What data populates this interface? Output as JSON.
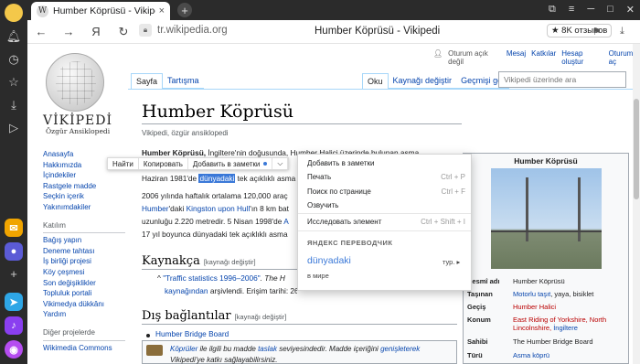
{
  "browser": {
    "tab_title": "Humber Köprüsü - Vikipedi",
    "tab_favicon": "W",
    "new_tab": "+",
    "url": "tr.wikipedia.org",
    "page_title": "Humber Köprüsü - Vikipedi",
    "reviews": "★ 8K отзывов",
    "yandex_glyph": "Я"
  },
  "wiki": {
    "wordmark": "VİKİPEDİ",
    "tagline": "Özgür Ansiklopedi",
    "personal": {
      "not_logged": "Oturum açık değil",
      "talk": "Mesaj",
      "contribs": "Katkılar",
      "create": "Hesap oluştur",
      "login": "Oturum aç"
    },
    "tabs": {
      "article": "Sayfa",
      "talk": "Tartışma",
      "read": "Oku",
      "edit": "Kaynağı değiştir",
      "history": "Geçmişi gör"
    },
    "search_placeholder": "Vikipedi üzerinde ara",
    "nav": [
      "Anasayfa",
      "Hakkımızda",
      "İçindekiler",
      "Rastgele madde",
      "Seçkin içerik",
      "Yakınımdakiler"
    ],
    "nav_header2": "Katılım",
    "nav2": [
      "Bağış yapın",
      "Deneme tahtası",
      "İş birliği projesi",
      "Köy çeşmesi",
      "Son değişiklikler",
      "Topluluk portali",
      "Vikimedya dükkânı",
      "Yardım"
    ],
    "nav_header3": "Diğer projelerde",
    "nav3": [
      "Wikimedia Commons"
    ],
    "title": "Humber Köprüsü",
    "from": "Vikipedi, özgür ansiklopedi",
    "para": {
      "l1_a": "Humber Köprüsü, ",
      "l1_b": "İngiltere'nin doğusunda, Humber Halici üzerinde bulunan asma",
      "l2_a": "Haziran 1981'de ",
      "l2_hl": "dünyadaki",
      "l2_b": " tek açıklıklı asma",
      "l3": "2006 yılında haftalık ortalama 120,000 araç",
      "l4_a": "Humber",
      "l4_b": "'daki ",
      "l4_c": "Kingston upon Hull",
      "l4_d": "'ın 8 km bat",
      "l5_a": "uzunluğu 2.220 metredir. 5 Nisan 1998'de ",
      "l5_b": "A",
      "l6": "17 yıl boyunca dünyadaki tek açıklıklı asma"
    },
    "refs_h": "Kaynakça",
    "edit_link": "[kaynağı değiştir]",
    "ref1_a": "^",
    "ref1_b": "\"Traffic statistics 1996–2006\"",
    "ref1_c": ". The H",
    "ref2_a": "kaynağından",
    "ref2_b": " arşivlendi. Erişim tarihi: 26 Mart 2007.",
    "ext_h": "Dış bağlantılar",
    "ext1": "Humber Bridge Board",
    "stub_a": "Köprüler",
    "stub_b": " ile ilgili bu madde ",
    "stub_c": "taslak",
    "stub_d": " seviyesindedir. Madde içeriğini ",
    "stub_e": "genişleterek",
    "stub_f": "Vikipedi'ye katkı sağlayabilirsiniz."
  },
  "infobox": {
    "title": "Humber Köprüsü",
    "rows": [
      {
        "k": "Resmî adı",
        "v": "Humber Köprüsü"
      },
      {
        "k": "Taşınan",
        "v1": "Motorlu taşıt",
        "v2": ", yaya, bisiklet"
      },
      {
        "k": "Geçiş",
        "v": "Humber Halici"
      },
      {
        "k": "Konum",
        "v1": "East Riding of Yorkshire, North Lincolnshire, ",
        "v2": "İngiltere"
      },
      {
        "k": "Sahibi",
        "v": "The Humber Bridge Board"
      },
      {
        "k": "Türü",
        "v": "Asma köprü"
      }
    ]
  },
  "selection_toolbar": {
    "find": "Найти",
    "copy": "Копировать",
    "add_note": "Добавить в заметки",
    "more": "⌵"
  },
  "context_menu": {
    "items": [
      {
        "label": "Добавить в заметки",
        "shortcut": ""
      },
      {
        "label": "Печать",
        "shortcut": "Ctrl + P"
      },
      {
        "label": "Поиск по странице",
        "shortcut": "Ctrl + F"
      },
      {
        "label": "Озвучить",
        "shortcut": ""
      },
      {
        "label": "Исследовать элемент",
        "shortcut": "Ctrl + Shift + I"
      }
    ],
    "translator_header": "ЯНДЕКС ПЕРЕВОДЧИК",
    "translated_word": "dünyadaki",
    "lang": "тур. ▸",
    "translation": "в мире"
  }
}
